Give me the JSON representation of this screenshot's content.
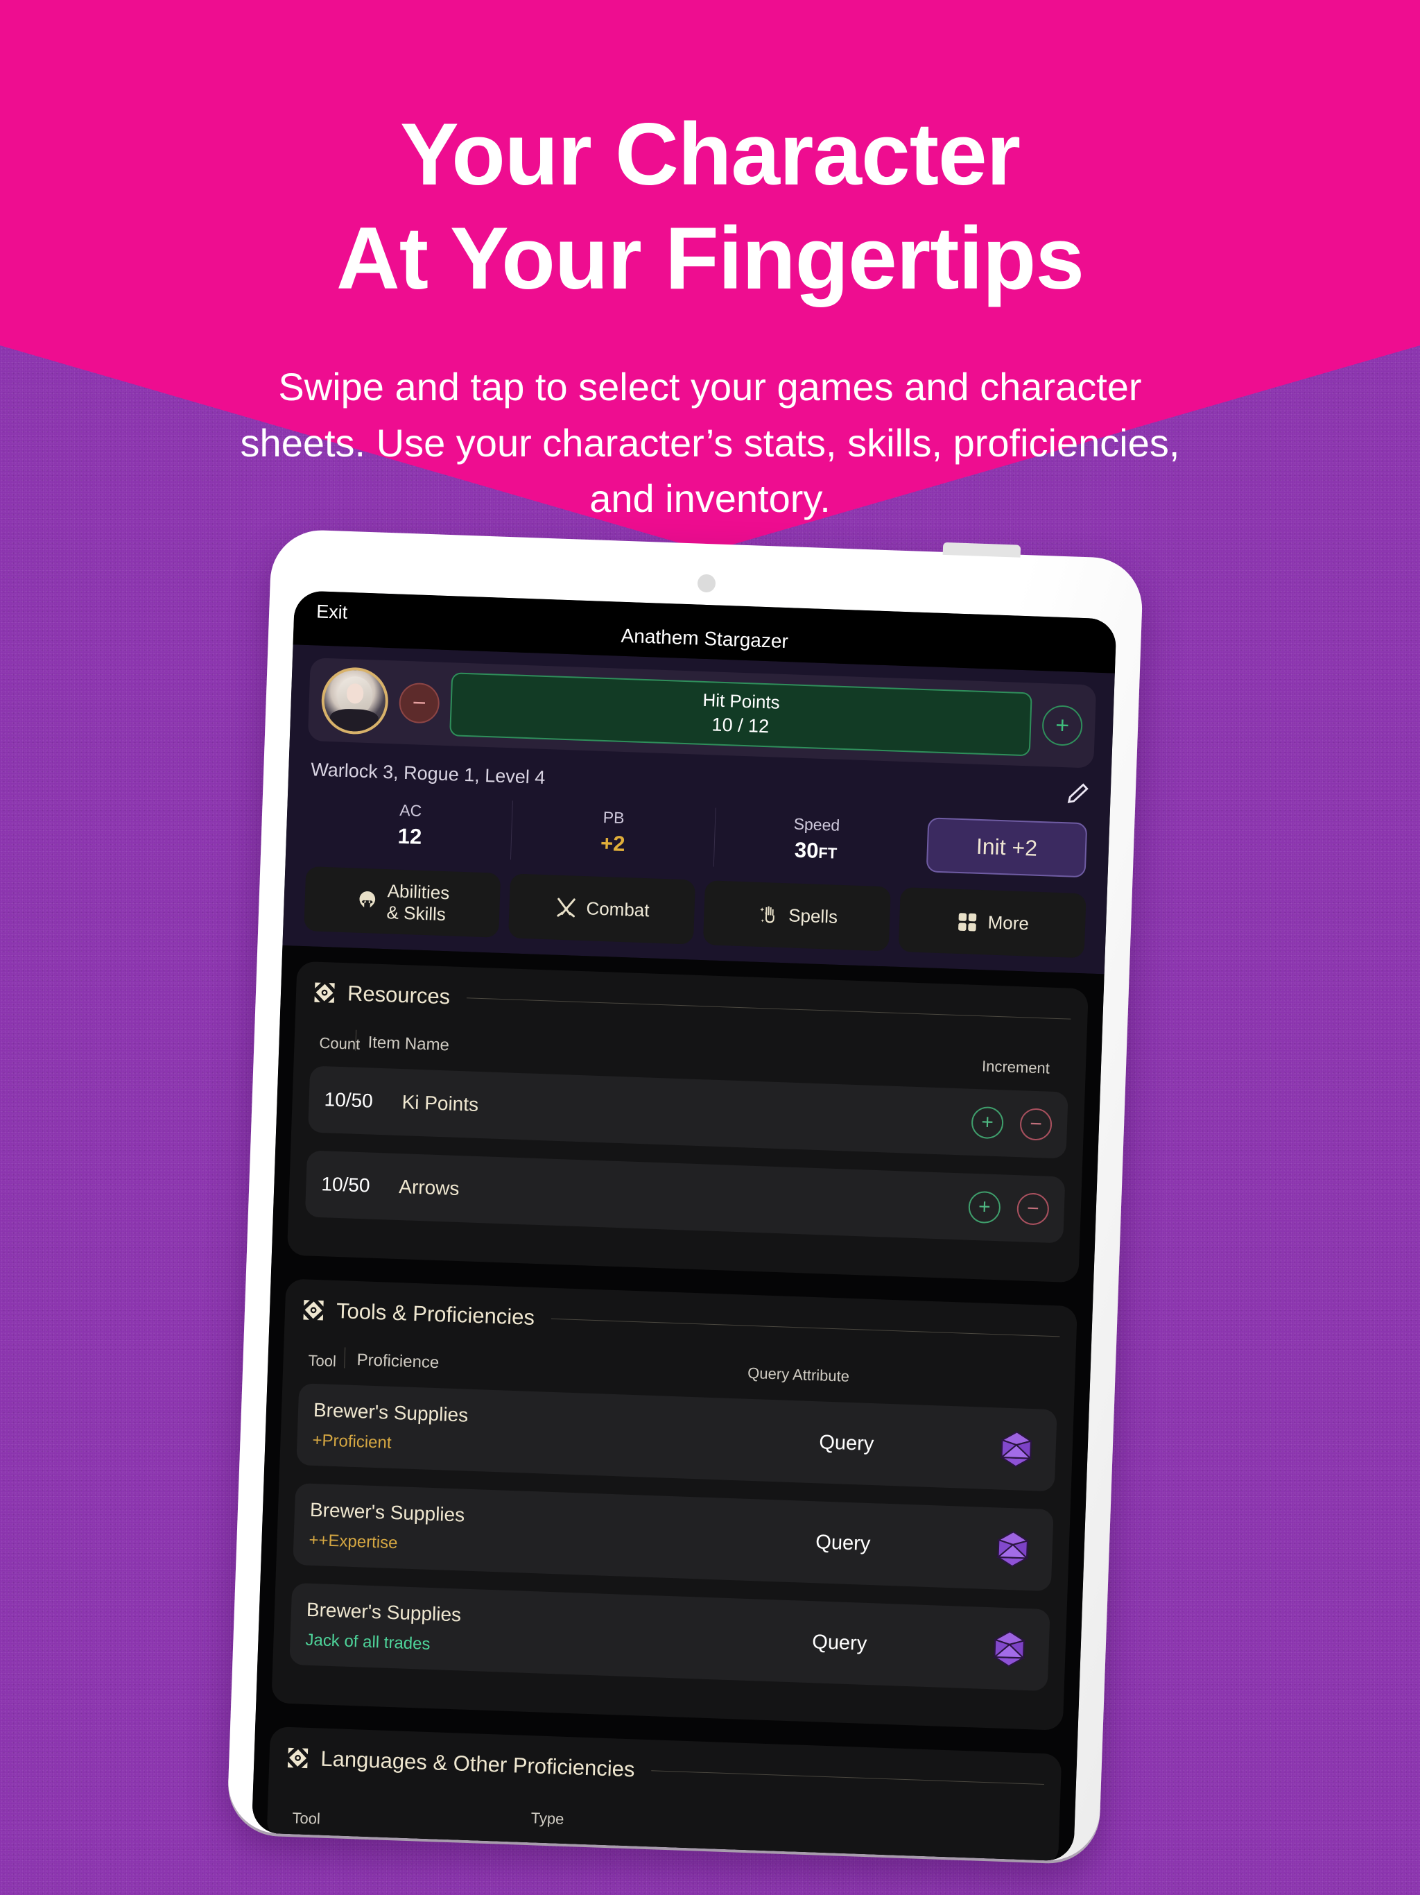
{
  "palette": {
    "pink": "#EE0D90",
    "purple": "#8B34AE",
    "gold": "#efe7d0",
    "green": "#3fbd7c",
    "red": "#c2707c",
    "d20_purple": "#8e52d6",
    "init_purple": "#3b2a60"
  },
  "hero": {
    "headline_line1": "Your Character",
    "headline_line2": "At Your Fingertips",
    "subhead": "Swipe and tap to select your games and character sheets. Use your character’s stats, skills, proficiencies, and inventory."
  },
  "app": {
    "navbar": {
      "exit_label": "Exit",
      "title": "Anathem Stargazer"
    },
    "header": {
      "avatar_name": "character-portrait",
      "decrement_label": "−",
      "increment_label": "+",
      "hp_label": "Hit Points",
      "hp_value": "10 / 12",
      "class_line": "Warlock 3, Rogue 1, Level 4",
      "edit_icon": "pencil-icon",
      "stats": [
        {
          "key": "AC",
          "value": "12",
          "unit": "",
          "gold": false
        },
        {
          "key": "PB",
          "value": "+2",
          "unit": "",
          "gold": true
        },
        {
          "key": "Speed",
          "value": "30",
          "unit": "FT",
          "gold": false
        }
      ],
      "init_label": "Init +2"
    },
    "tabs": [
      {
        "label_line1": "Abilities",
        "label_line2": "& Skills",
        "icon": "helm-icon"
      },
      {
        "label_line1": "Combat",
        "label_line2": "",
        "icon": "swords-icon"
      },
      {
        "label_line1": "Spells",
        "label_line2": "",
        "icon": "magic-hand-icon"
      },
      {
        "label_line1": "More",
        "label_line2": "",
        "icon": "grid-icon"
      }
    ],
    "resources": {
      "title": "Resources",
      "icon": "gem-diamond-icon",
      "columns": {
        "count": "Count",
        "item_name": "Item Name",
        "increment": "Increment"
      },
      "rows": [
        {
          "count": "10/50",
          "name": "Ki Points"
        },
        {
          "count": "10/50",
          "name": "Arrows"
        }
      ]
    },
    "tools": {
      "title": "Tools & Proficiencies",
      "icon": "gem-diamond-icon",
      "columns": {
        "tool": "Tool",
        "proficience": "Proficience",
        "query_attribute": "Query Attribute"
      },
      "rows": [
        {
          "name": "Brewer's Supplies",
          "proficiency": "+Proficient",
          "style": "prof",
          "query": "Query",
          "dice": "d20-icon"
        },
        {
          "name": "Brewer's Supplies",
          "proficiency": "++Expertise",
          "style": "exp",
          "query": "Query",
          "dice": "d20-icon"
        },
        {
          "name": "Brewer's Supplies",
          "proficiency": "Jack of all trades",
          "style": "jack",
          "query": "Query",
          "dice": "d20-icon"
        }
      ]
    },
    "languages": {
      "title": "Languages & Other Proficiencies",
      "icon": "gem-diamond-icon",
      "columns": {
        "tool": "Tool",
        "type": "Type"
      }
    }
  }
}
